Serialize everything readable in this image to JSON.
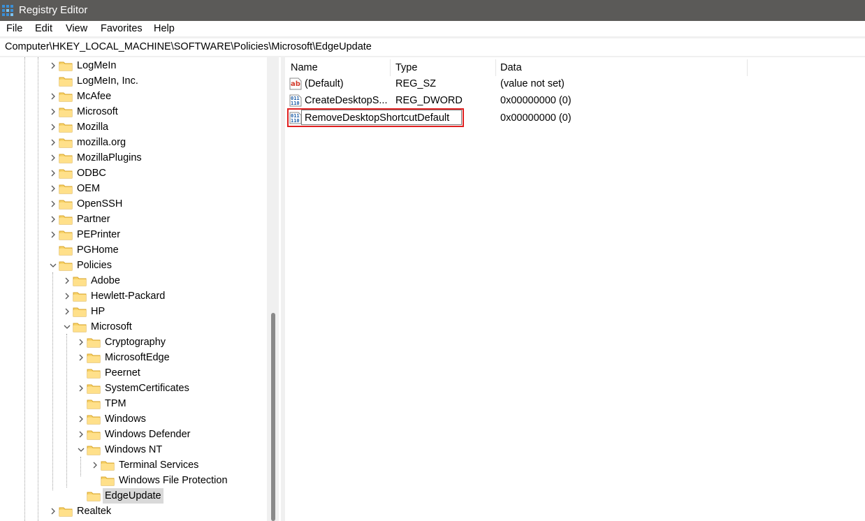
{
  "window": {
    "title": "Registry Editor"
  },
  "menu": {
    "items": [
      "File",
      "Edit",
      "View",
      "Favorites",
      "Help"
    ]
  },
  "address": {
    "path": "Computer\\HKEY_LOCAL_MACHINE\\SOFTWARE\\Policies\\Microsoft\\EdgeUpdate"
  },
  "tree": {
    "items": [
      {
        "label": "LogMeIn",
        "expander": "collapsed"
      },
      {
        "label": "LogMeIn, Inc.",
        "expander": "none"
      },
      {
        "label": "McAfee",
        "expander": "collapsed"
      },
      {
        "label": "Microsoft",
        "expander": "collapsed"
      },
      {
        "label": "Mozilla",
        "expander": "collapsed"
      },
      {
        "label": "mozilla.org",
        "expander": "collapsed"
      },
      {
        "label": "MozillaPlugins",
        "expander": "collapsed"
      },
      {
        "label": "ODBC",
        "expander": "collapsed"
      },
      {
        "label": "OEM",
        "expander": "collapsed"
      },
      {
        "label": "OpenSSH",
        "expander": "collapsed"
      },
      {
        "label": "Partner",
        "expander": "collapsed"
      },
      {
        "label": "PEPrinter",
        "expander": "collapsed"
      },
      {
        "label": "PGHome",
        "expander": "none"
      },
      {
        "label": "Policies",
        "expander": "expanded"
      },
      {
        "label": "Adobe",
        "expander": "collapsed"
      },
      {
        "label": "Hewlett-Packard",
        "expander": "collapsed"
      },
      {
        "label": "HP",
        "expander": "collapsed"
      },
      {
        "label": "Microsoft",
        "expander": "expanded"
      },
      {
        "label": "Cryptography",
        "expander": "collapsed"
      },
      {
        "label": "MicrosoftEdge",
        "expander": "collapsed"
      },
      {
        "label": "Peernet",
        "expander": "none"
      },
      {
        "label": "SystemCertificates",
        "expander": "collapsed"
      },
      {
        "label": "TPM",
        "expander": "none"
      },
      {
        "label": "Windows",
        "expander": "collapsed"
      },
      {
        "label": "Windows Defender",
        "expander": "collapsed"
      },
      {
        "label": "Windows NT",
        "expander": "expanded"
      },
      {
        "label": "Terminal Services",
        "expander": "collapsed"
      },
      {
        "label": "Windows File Protection",
        "expander": "none"
      },
      {
        "label": "EdgeUpdate",
        "expander": "none",
        "selected": true
      },
      {
        "label": "Realtek",
        "expander": "collapsed"
      }
    ]
  },
  "list": {
    "columns": [
      "Name",
      "Type",
      "Data"
    ],
    "rows": [
      {
        "name": "(Default)",
        "type": "REG_SZ",
        "data": "(value not set)",
        "icon": "string-value-icon"
      },
      {
        "name": "CreateDesktopS...",
        "type": "REG_DWORD",
        "data": "0x00000000 (0)",
        "icon": "binary-value-icon"
      },
      {
        "name": "RemoveDesktopShortcutDefault",
        "type": "",
        "data": "0x00000000 (0)",
        "icon": "binary-value-icon",
        "editing": true
      }
    ]
  },
  "colors": {
    "titlebar": "#5b5a58",
    "folder": "#f8d46b",
    "highlight": "#e02020",
    "selection": "#d9d9d9"
  }
}
